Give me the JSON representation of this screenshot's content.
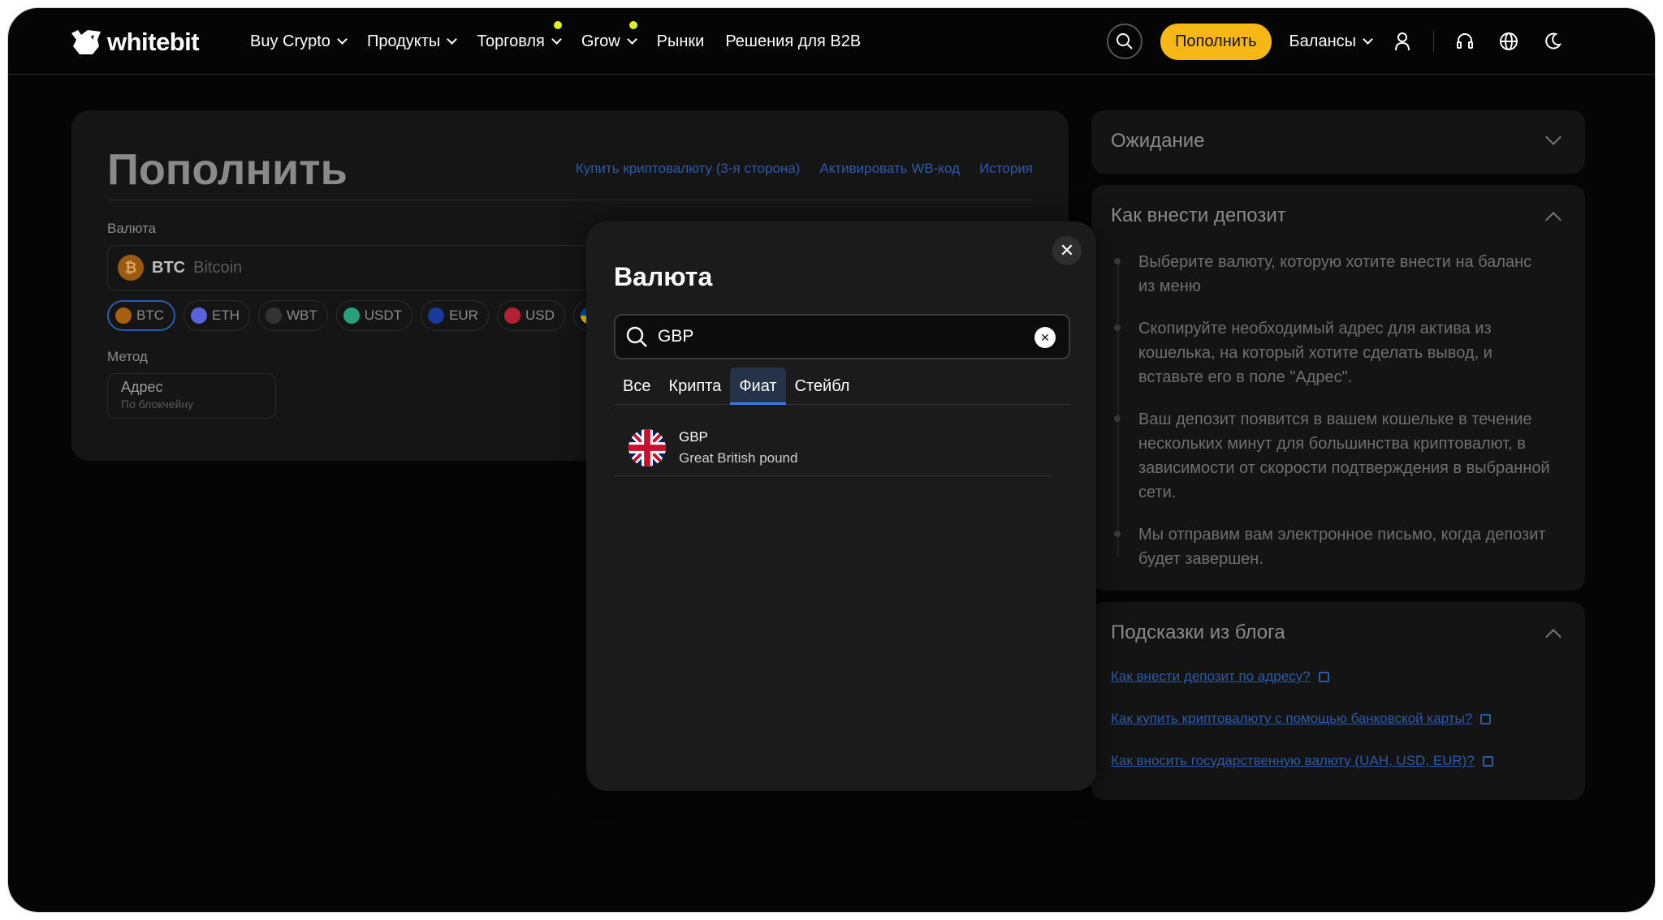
{
  "header": {
    "logo": "whitebit",
    "nav": [
      {
        "label": "Buy Crypto",
        "has_chevron": true,
        "dot": false
      },
      {
        "label": "Продукты",
        "has_chevron": true,
        "dot": false
      },
      {
        "label": "Торговля",
        "has_chevron": true,
        "dot": true
      },
      {
        "label": "Grow",
        "has_chevron": true,
        "dot": true
      },
      {
        "label": "Рынки",
        "has_chevron": false,
        "dot": false
      },
      {
        "label": "Решения для B2B",
        "has_chevron": false,
        "dot": false
      }
    ],
    "deposit_button": "Пополнить",
    "balances": "Балансы",
    "icons": [
      "search-icon",
      "user-icon",
      "support-icon",
      "globe-icon",
      "moon-icon"
    ],
    "accent_color": "#f7b716",
    "dot_color": "#dcf21f"
  },
  "main": {
    "title": "Пополнить",
    "links": [
      "Купить криптовалюту (3-я сторона)",
      "Активировать WB-код",
      "История"
    ],
    "currency_label": "Валюта",
    "selected_currency": {
      "code": "BTC",
      "name": "Bitcoin"
    },
    "chips": [
      {
        "code": "BTC",
        "active": true,
        "color": "#a8600f"
      },
      {
        "code": "ETH",
        "active": false,
        "color": "#5a63d8"
      },
      {
        "code": "WBT",
        "active": false,
        "color": "#333333"
      },
      {
        "code": "USDT",
        "active": false,
        "color": "#26a17b"
      },
      {
        "code": "EUR",
        "active": false,
        "color": "#1a3a9a"
      },
      {
        "code": "USD",
        "active": false,
        "color": "#b22234"
      },
      {
        "code": "UAH",
        "active": false,
        "color": "#0057b7"
      }
    ],
    "method_label": "Метод",
    "method": {
      "title": "Адрес",
      "subtitle": "По блокчейну"
    }
  },
  "side": {
    "pending": {
      "title": "Ожидание"
    },
    "howto": {
      "title": "Как внести депозит",
      "steps": [
        "Выберите валюту, которую хотите внести на баланс из меню",
        "Скопируйте необходимый адрес для актива из кошелька, на который хотите сделать вывод, и вставьте его в поле \"Адрес\".",
        "Ваш депозит появится в вашем кошельке в течение нескольких минут для большинства криптовалют, в зависимости от скорости подтверждения в выбранной сети.",
        "Мы отправим вам электронное письмо, когда депозит будет завершен."
      ]
    },
    "blog": {
      "title": "Подсказки из блога",
      "links": [
        "Как внести депозит по адресу?",
        "Как купить криптовалюту с помощью банковской карты?",
        "Как вносить государственную валюту (UAH, USD, EUR)?"
      ]
    }
  },
  "modal": {
    "title": "Валюта",
    "search_value": "GBP",
    "tabs": [
      {
        "label": "Все",
        "active": false
      },
      {
        "label": "Крипта",
        "active": false
      },
      {
        "label": "Фиат",
        "active": true
      },
      {
        "label": "Стейбл",
        "active": false
      }
    ],
    "results": [
      {
        "code": "GBP",
        "name": "Great British pound",
        "icon": "uk-flag-icon"
      }
    ]
  }
}
